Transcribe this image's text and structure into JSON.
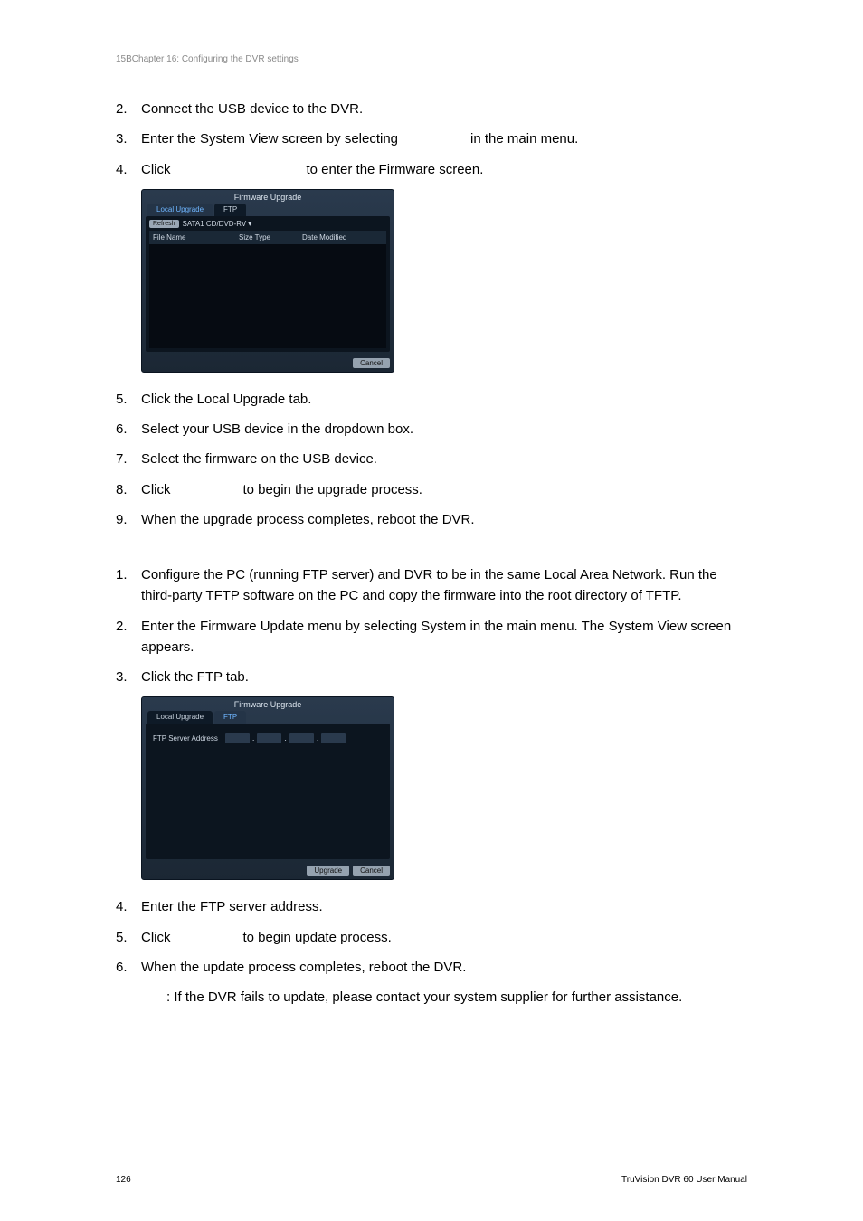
{
  "header": {
    "chapter": "15BChapter 16: Configuring the DVR settings"
  },
  "listA": {
    "i2": {
      "num": "2.",
      "text": "Connect the USB device to the DVR."
    },
    "i3": {
      "num": "3.",
      "pre": "Enter the System View screen by selecting",
      "post": "in the main menu."
    },
    "i4": {
      "num": "4.",
      "pre": "Click",
      "post": "to enter the Firmware screen."
    }
  },
  "panel1": {
    "title": "Firmware Upgrade",
    "tab_local": "Local Upgrade",
    "tab_ftp": "FTP",
    "refresh": "Refresh",
    "device": "SATA1 CD/DVD-RV",
    "col_file": "File Name",
    "col_size": "Size Type",
    "col_date": "Date Modified",
    "cancel": "Cancel"
  },
  "listB": {
    "i5": {
      "num": "5.",
      "text": "Click the Local Upgrade tab."
    },
    "i6": {
      "num": "6.",
      "text": "Select your USB device in the dropdown box."
    },
    "i7": {
      "num": "7.",
      "text": "Select the firmware on the USB device."
    },
    "i8": {
      "num": "8.",
      "pre": "Click",
      "post": "to begin the upgrade process."
    },
    "i9": {
      "num": "9.",
      "text": "When the upgrade process completes, reboot the DVR."
    }
  },
  "listC": {
    "i1": {
      "num": "1.",
      "text": "Configure the PC (running FTP server) and DVR to be in the same Local Area Network. Run the third-party TFTP software on the PC and copy the firmware into the root directory of TFTP."
    },
    "i2": {
      "num": "2.",
      "text": "Enter the Firmware Update menu by selecting System in the main menu. The System View screen appears."
    },
    "i3": {
      "num": "3.",
      "text": "Click the FTP tab."
    }
  },
  "panel2": {
    "title": "Firmware Upgrade",
    "tab_local": "Local Upgrade",
    "tab_ftp": "FTP",
    "label": "FTP Server Address",
    "upgrade": "Upgrade",
    "cancel": "Cancel"
  },
  "listD": {
    "i4": {
      "num": "4.",
      "text": "Enter the FTP server address."
    },
    "i5": {
      "num": "5.",
      "pre": "Click",
      "post": "to begin update process."
    },
    "i6": {
      "num": "6.",
      "text": "When the update process completes, reboot the DVR."
    }
  },
  "note": {
    "colon": ": ",
    "text": "If the DVR fails to update, please contact your system supplier for further assistance."
  },
  "footer": {
    "page": "126",
    "manual": "TruVision DVR 60 User Manual"
  }
}
